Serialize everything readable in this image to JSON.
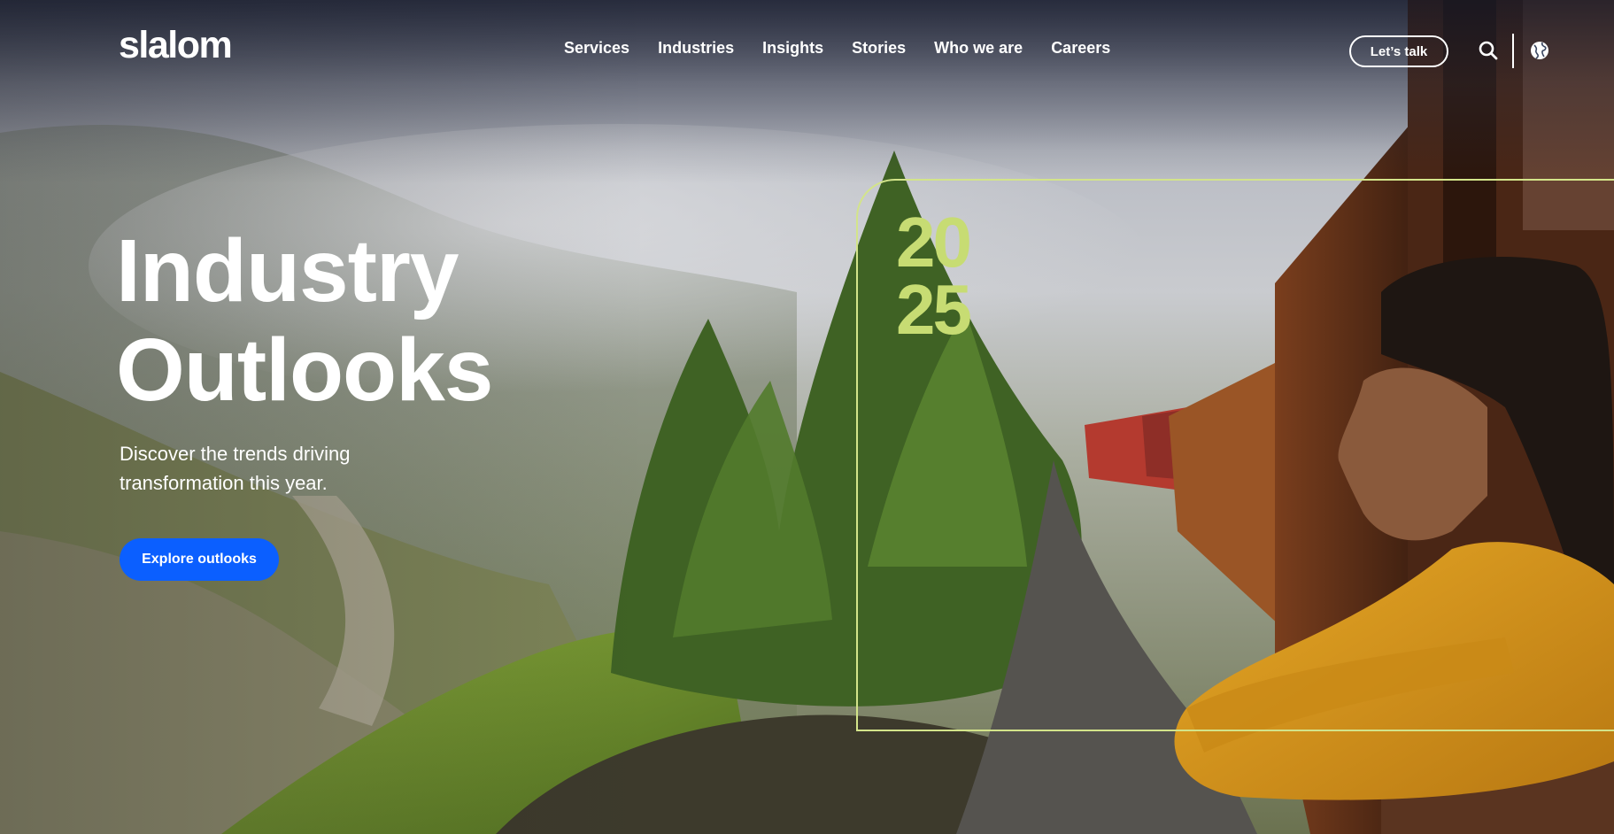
{
  "brand": {
    "logo_text": "slalom"
  },
  "nav": {
    "items": [
      "Services",
      "Industries",
      "Insights",
      "Stories",
      "Who we are",
      "Careers"
    ]
  },
  "header_actions": {
    "cta_label": "Let’s talk",
    "search_icon": "search-icon",
    "globe_icon": "globe-icon"
  },
  "hero": {
    "title_line1": "Industry",
    "title_line2": "Outlooks",
    "subtitle": "Discover the trends driving transformation this year.",
    "button_label": "Explore outlooks",
    "year_top": "20",
    "year_bottom": "25"
  },
  "colors": {
    "accent_blue": "#0b5fff",
    "frame_lime": "#d3e48a",
    "year_lime": "#c7dc73",
    "sweater_mustard": "#d99a1c"
  }
}
